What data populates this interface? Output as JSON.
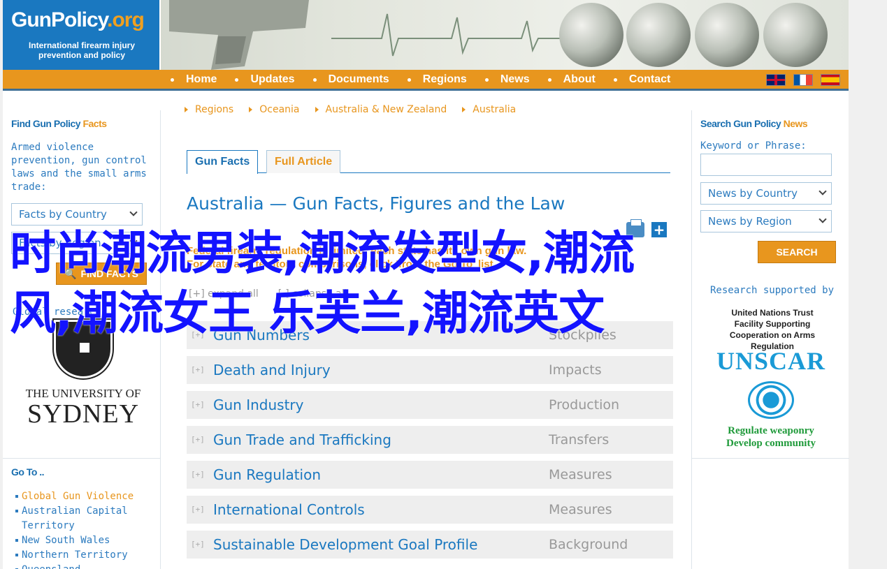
{
  "site": {
    "logo_title": "GunPolicy",
    "logo_tld": ".org",
    "logo_subtitle": "International firearm injury prevention and policy"
  },
  "nav": {
    "items": [
      "Home",
      "Updates",
      "Documents",
      "Regions",
      "News",
      "About",
      "Contact"
    ],
    "languages": [
      "english-flag-icon",
      "french-flag-icon",
      "spanish-flag-icon"
    ]
  },
  "left_sidebar": {
    "heading_prefix": "Find Gun Policy ",
    "heading_highlight": "Facts",
    "description": "Armed violence prevention, gun control laws and the small arms trade:",
    "select_country": "Facts by Country",
    "select_region": "Facts by Region",
    "find_button": "FIND FACTS",
    "supported_by": "Global research",
    "sydney_line1": "THE UNIVERSITY OF",
    "sydney_line2": "SYDNEY",
    "goto_heading": "Go To ..",
    "goto_items": [
      "Global Gun Violence",
      "Australian Capital Territory",
      "New South Wales",
      "Northern Territory",
      "Queensland"
    ]
  },
  "breadcrumb": [
    "Regions",
    "Oceania",
    "Australia & New Zealand",
    "Australia"
  ],
  "tabs": {
    "facts": "Gun Facts",
    "article": "Full Article"
  },
  "main": {
    "title": "Australia — Gun Facts, Figures and the Law",
    "note_line1": "Federal firearm regulation is limited: each state has its own gun law.",
    "note_line2": "For state and territory comparisons, click 'from the Go To' list.",
    "expand_all": "[+] expand all",
    "collapse_all": "[-] collapse all",
    "rows": [
      {
        "label": "Gun Numbers",
        "category": "Stockpiles"
      },
      {
        "label": "Death and Injury",
        "category": "Impacts"
      },
      {
        "label": "Gun Industry",
        "category": "Production"
      },
      {
        "label": "Gun Trade and Trafficking",
        "category": "Transfers"
      },
      {
        "label": "Gun Regulation",
        "category": "Measures"
      },
      {
        "label": "International Controls",
        "category": "Measures"
      },
      {
        "label": "Sustainable Development Goal Profile",
        "category": "Background"
      }
    ],
    "row_marker": "[+]"
  },
  "right_sidebar": {
    "heading_prefix": "Search Gun Policy ",
    "heading_highlight": "News",
    "keyword_label": "Keyword or Phrase:",
    "select_country": "News by Country",
    "select_region": "News by Region",
    "search_button": "SEARCH",
    "supported_text": "Research supported by",
    "untf_text": "United Nations Trust Facility Supporting Cooperation on Arms Regulation",
    "unscar": "UNSCAR",
    "green_line1": "Regulate weaponry",
    "green_line2": "Develop community"
  },
  "overlay": {
    "line1": "时尚潮流男装,潮流发型女,潮流",
    "line2": "风,潮流女王 乐芙兰,潮流英文"
  },
  "colors": {
    "brand_blue": "#1a78c0",
    "accent_orange": "#e8961e",
    "overlay_blue": "#1313ff"
  }
}
